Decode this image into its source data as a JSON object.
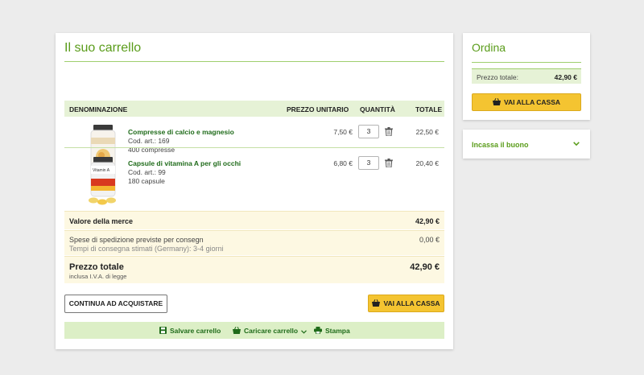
{
  "cart": {
    "title": "Il suo carrello",
    "columns": {
      "name": "DENOMINAZIONE",
      "unit_price": "PREZZO UNITARIO",
      "qty": "QUANTITÀ",
      "total": "TOTALE"
    },
    "items": [
      {
        "name": "Compresse di calcio e magnesio",
        "code": "Cod. art.: 169",
        "pack": "400 compresse",
        "unit_price": "7,50 €",
        "qty": "3",
        "total": "22,50 €"
      },
      {
        "name": "Capsule di vitamina A per gli occhi",
        "code": "Cod. art.: 99",
        "pack": "180 capsule",
        "unit_price": "6,80 €",
        "qty": "3",
        "total": "20,40 €"
      }
    ],
    "summary": {
      "goods_label": "Valore della merce",
      "goods_value": "42,90 €",
      "shipping_label": "Spese di spedizione previste per consegn",
      "shipping_value": "0,00 €",
      "delivery_time": "Tempi di consegna stimati (Germany): 3-4 giorni",
      "total_label": "Prezzo totale",
      "total_value": "42,90 €",
      "vat_note": "inclusa I.V.A. di legge"
    },
    "continue_label": "CONTINUA AD ACQUISTARE",
    "checkout_label": "VAI ALLA CASSA",
    "actions": {
      "save": "Salvare carrello",
      "load": "Caricare carrello",
      "print": "Stampa"
    }
  },
  "order": {
    "title": "Ordina",
    "total_label": "Prezzo totale:",
    "total_value": "42,90 €",
    "checkout_label": "VAI ALLA CASSA"
  },
  "voucher": {
    "label": "Incassa il buono"
  },
  "colors": {
    "accent_green": "#5a9c1a",
    "dark_green": "#1f6b1a",
    "button_yellow": "#f4c431",
    "light_green_bg": "#e6f2d6",
    "summary_bg": "#fdf8e2"
  }
}
